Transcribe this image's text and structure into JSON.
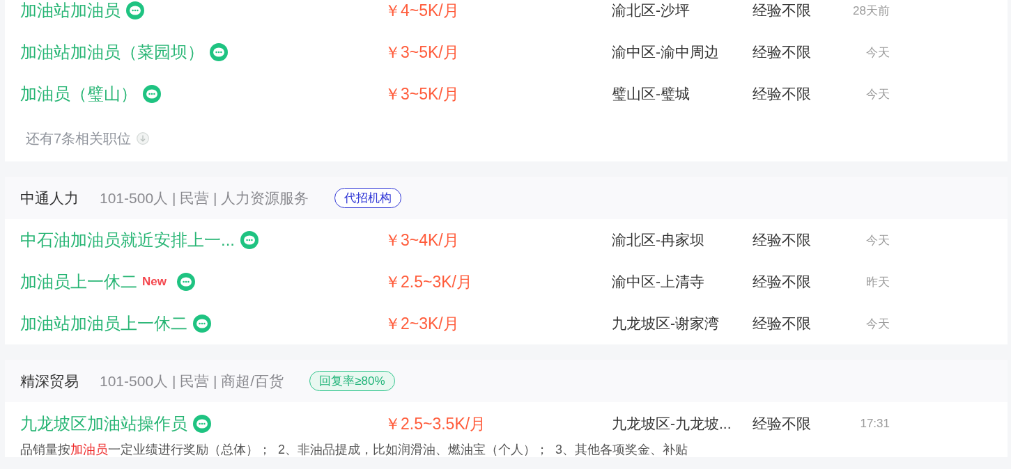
{
  "job_groups": [
    {
      "jobs": [
        {
          "title": "加油站加油员",
          "salary": "￥4~5K/月",
          "location": "渝北区-沙坪",
          "experience": "经验不限",
          "posted": "28天前"
        },
        {
          "title": "加油站加油员（菜园坝）",
          "salary": "￥3~5K/月",
          "location": "渝中区-渝中周边",
          "experience": "经验不限",
          "posted": "今天"
        },
        {
          "title": "加油员（璧山）",
          "salary": "￥3~5K/月",
          "location": "璧山区-璧城",
          "experience": "经验不限",
          "posted": "今天"
        }
      ],
      "more_link": "还有7条相关职位"
    },
    {
      "company": {
        "name": "中通人力",
        "info": "101-500人 | 民营 | 人力资源服务",
        "badge": {
          "kind": "agency",
          "text": "代招机构"
        }
      },
      "jobs": [
        {
          "title": "中石油加油员就近安排上一...",
          "salary": "￥3~4K/月",
          "location": "渝北区-冉家坝",
          "experience": "经验不限",
          "posted": "今天"
        },
        {
          "title": "加油员上一休二",
          "new_tag": "New",
          "salary": "￥2.5~3K/月",
          "location": "渝中区-上清寺",
          "experience": "经验不限",
          "posted": "昨天"
        },
        {
          "title": "加油站加油员上一休二",
          "salary": "￥2~3K/月",
          "location": "九龙坡区-谢家湾",
          "experience": "经验不限",
          "posted": "今天"
        }
      ]
    },
    {
      "company": {
        "name": "精深贸易",
        "info": "101-500人 | 民营 | 商超/百货",
        "badge": {
          "kind": "reply_rate",
          "text": "回复率≥80%"
        }
      },
      "jobs": [
        {
          "title": "九龙坡区加油站操作员",
          "salary": "￥2.5~3.5K/月",
          "location": "九龙坡区-九龙坡...",
          "experience": "经验不限",
          "posted": "17:31",
          "description": [
            {
              "text": "品销量按",
              "highlight": false
            },
            {
              "text": "加油员",
              "highlight": true
            },
            {
              "text": "一定业绩进行奖励（总体）；  2、非油品提成，比如润滑油、燃油宝（个人）；  3、其他各项奖金、补贴",
              "highlight": false
            }
          ]
        }
      ]
    }
  ]
}
